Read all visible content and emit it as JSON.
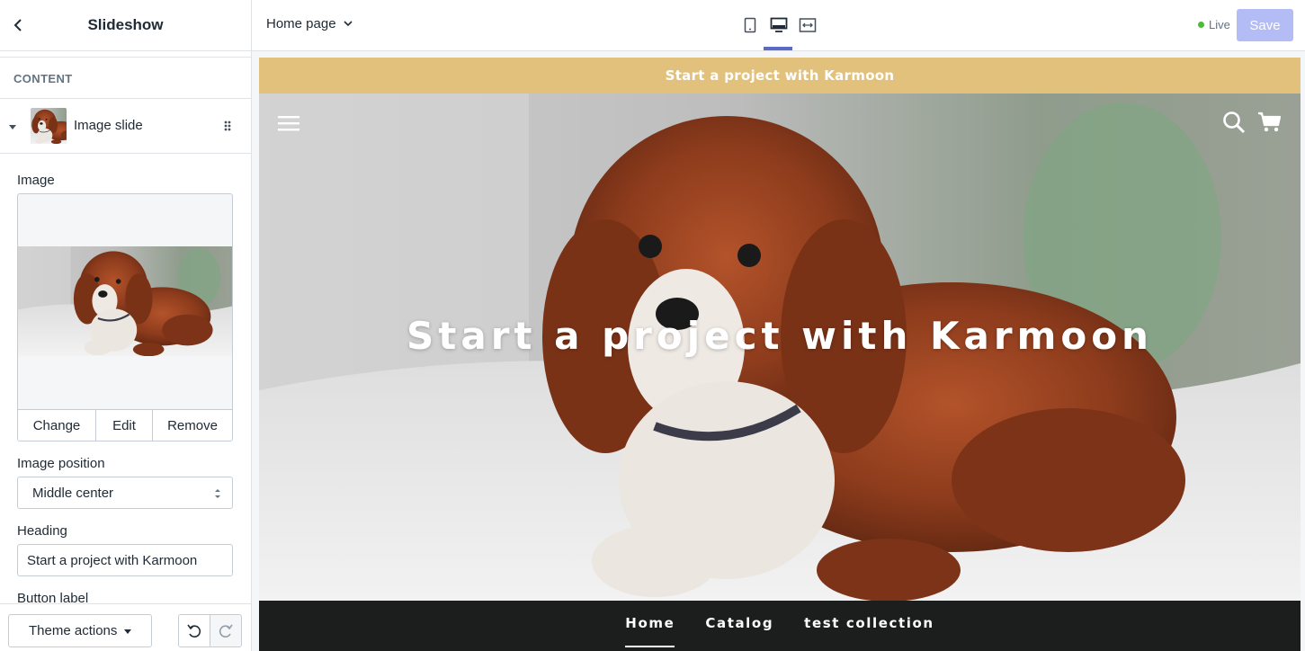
{
  "sidebar": {
    "title": "Slideshow",
    "section_label": "CONTENT",
    "block": {
      "label": "Image slide"
    },
    "fields": {
      "image_label": "Image",
      "image_actions": {
        "change": "Change",
        "edit": "Edit",
        "remove": "Remove"
      },
      "position_label": "Image position",
      "position_value": "Middle center",
      "heading_label": "Heading",
      "heading_value": "Start a project with Karmoon",
      "button_label": "Button label"
    },
    "footer": {
      "theme_actions": "Theme actions"
    }
  },
  "topbar": {
    "page_select": "Home page",
    "devices": [
      "mobile-icon",
      "desktop-icon",
      "fullscreen-icon"
    ],
    "active_device": "desktop",
    "live_label": "Live",
    "save_label": "Save"
  },
  "preview": {
    "announcement": "Start a project with Karmoon",
    "hero_heading": "Start a project with Karmoon",
    "nav": [
      "Home",
      "Catalog",
      "test collection"
    ],
    "active_nav": "Home"
  },
  "colors": {
    "accent": "#5c6ac4",
    "save_disabled": "#b3bcf5",
    "live_dot": "#50b83c",
    "announcement_bg": "#e2c17c",
    "nav_bg": "#1c1d1d"
  }
}
